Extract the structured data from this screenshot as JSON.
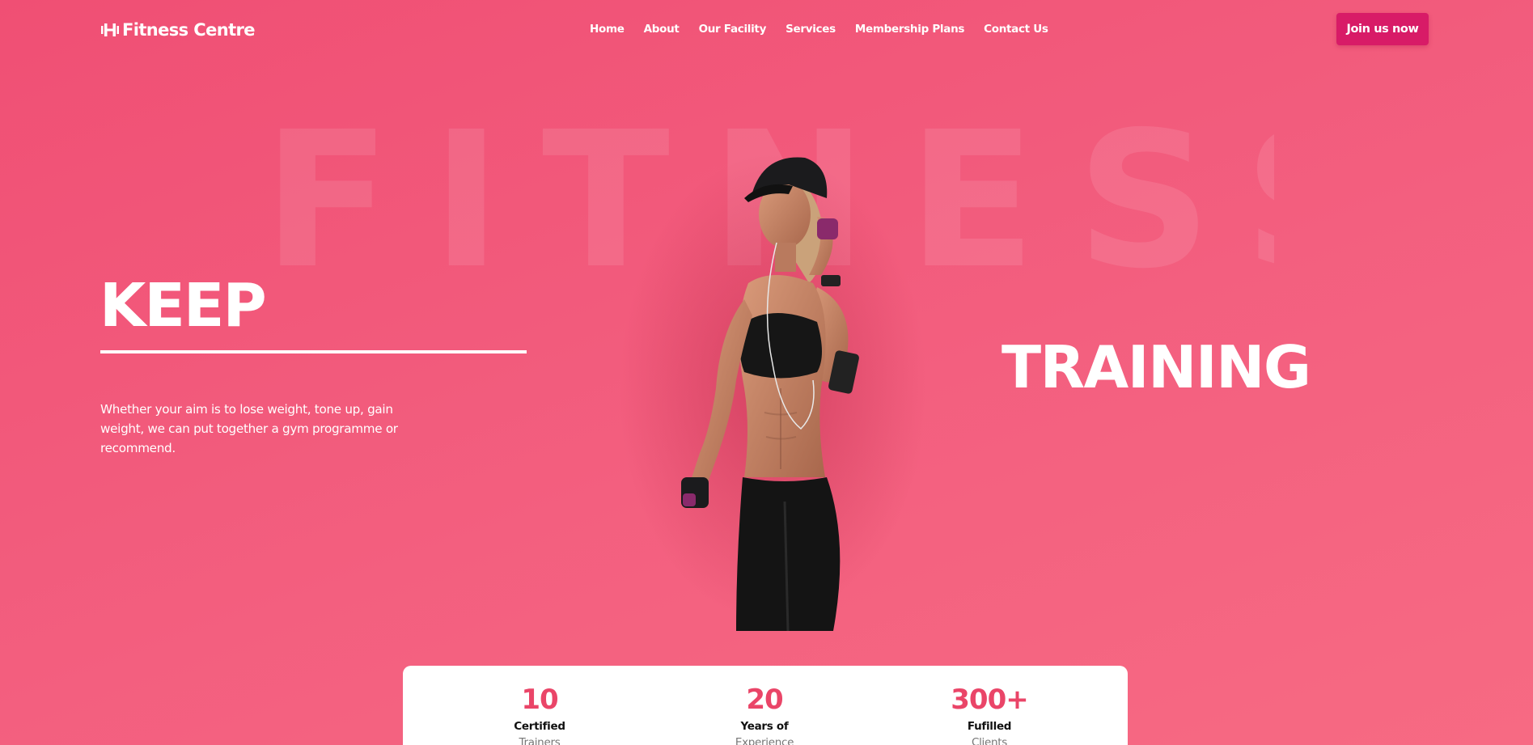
{
  "header": {
    "logo_text": "Fitness Centre",
    "logo_icon": "dumbbell-icon",
    "nav": [
      "Home",
      "About",
      "Our Facility",
      "Services",
      "Membership Plans",
      "Contact Us"
    ],
    "cta_label": "Join us now"
  },
  "hero": {
    "background_word": "FITNESS",
    "title_left": "KEEP",
    "title_right": "TRAINING",
    "description": "Whether your aim is to lose weight, tone up, gain weight, we can put together a gym programme or recommend."
  },
  "stats": [
    {
      "value": "10",
      "label": "Certified",
      "sub": "Trainers"
    },
    {
      "value": "20",
      "label": "Years of",
      "sub": "Experience"
    },
    {
      "value": "300+",
      "label": "Fufilled",
      "sub": "Clients"
    }
  ],
  "colors": {
    "background": "#f04f74",
    "accent": "#d81b67",
    "stat_number": "#ea4568"
  }
}
